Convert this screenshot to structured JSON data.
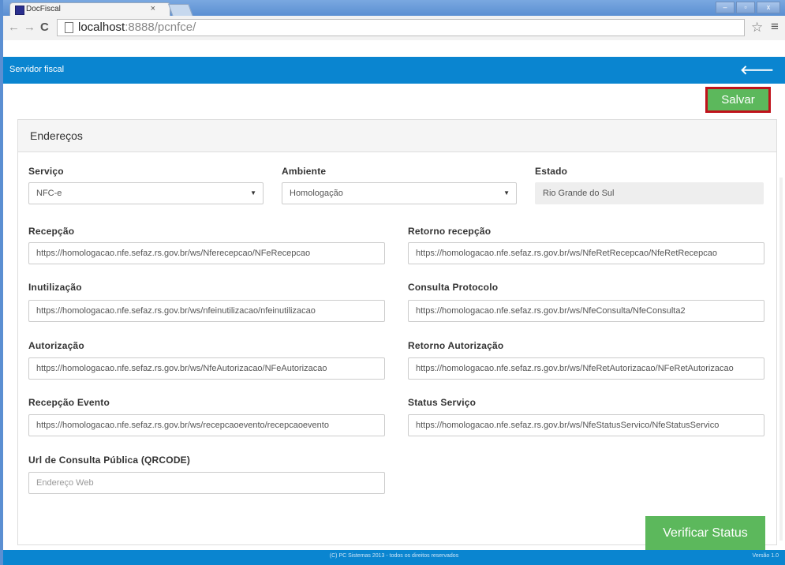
{
  "browser": {
    "tab_title": "DocFiscal",
    "tab_close": "×",
    "url_host": "localhost",
    "url_rest": ":8888/pcnfce/",
    "window_buttons": [
      "–",
      "▫",
      "x"
    ]
  },
  "app": {
    "header_title": "Servidor fiscal",
    "back_glyph": "🡐",
    "save_label": "Salvar"
  },
  "panel": {
    "title": "Endereços"
  },
  "form": {
    "servico": {
      "label": "Serviço",
      "value": "NFC-e"
    },
    "ambiente": {
      "label": "Ambiente",
      "value": "Homologação"
    },
    "estado": {
      "label": "Estado",
      "value": "Rio Grande do Sul"
    },
    "recepcao": {
      "label": "Recepção",
      "value": "https://homologacao.nfe.sefaz.rs.gov.br/ws/Nferecepcao/NFeRecepcao"
    },
    "retorno_recepcao": {
      "label": "Retorno recepção",
      "value": "https://homologacao.nfe.sefaz.rs.gov.br/ws/NfeRetRecepcao/NfeRetRecepcao"
    },
    "inutilizacao": {
      "label": "Inutilização",
      "value": "https://homologacao.nfe.sefaz.rs.gov.br/ws/nfeinutilizacao/nfeinutilizacao"
    },
    "consulta_protocolo": {
      "label": "Consulta Protocolo",
      "value": "https://homologacao.nfe.sefaz.rs.gov.br/ws/NfeConsulta/NfeConsulta2"
    },
    "autorizacao": {
      "label": "Autorização",
      "value": "https://homologacao.nfe.sefaz.rs.gov.br/ws/NfeAutorizacao/NFeAutorizacao"
    },
    "retorno_autorizacao": {
      "label": "Retorno Autorização",
      "value": "https://homologacao.nfe.sefaz.rs.gov.br/ws/NfeRetAutorizacao/NFeRetAutorizacao"
    },
    "recepcao_evento": {
      "label": "Recepção Evento",
      "value": "https://homologacao.nfe.sefaz.rs.gov.br/ws/recepcaoevento/recepcaoevento"
    },
    "status_servico": {
      "label": "Status Serviço",
      "value": "https://homologacao.nfe.sefaz.rs.gov.br/ws/NfeStatusServico/NfeStatusServico"
    },
    "url_consulta": {
      "label": "Url de Consulta Pública (QRCODE)",
      "placeholder": "Endereço Web"
    }
  },
  "verify_label": "Verificar Status",
  "footer": {
    "copyright": "(C) PC Sistemas 2013 - todos os direitos reservados",
    "version": "Versão 1.0"
  },
  "colors": {
    "primary": "#0a85d0",
    "success": "#5cb85c",
    "highlight": "#c0121b"
  }
}
